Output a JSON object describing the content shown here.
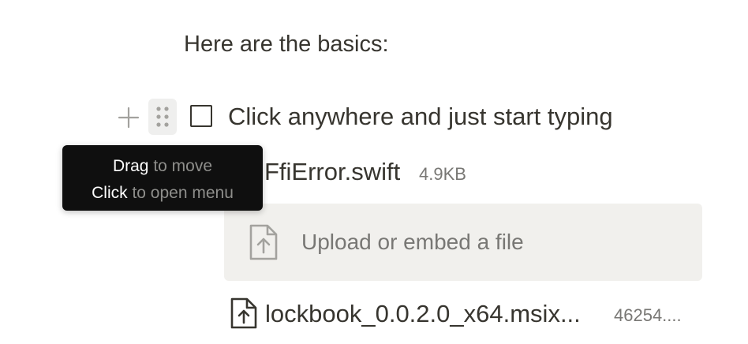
{
  "heading": {
    "text": "Here are the basics:"
  },
  "todo": {
    "text": "Click anywhere and just start typing",
    "checked": false
  },
  "block_controls": {
    "add_icon": "plus-icon",
    "drag_icon": "drag-handle-icon"
  },
  "tooltip": {
    "line1_strong": "Drag",
    "line1_rest": " to move",
    "line2_strong": "Click",
    "line2_rest": " to open menu"
  },
  "files": [
    {
      "name": "FfiError.swift",
      "size": "4.9KB"
    },
    {
      "name": "lockbook_0.0.2.0_x64.msix...",
      "size": "46254....",
      "icon": "file-upload-icon"
    }
  ],
  "upload": {
    "label": "Upload or embed a file",
    "icon": "file-upload-icon"
  }
}
